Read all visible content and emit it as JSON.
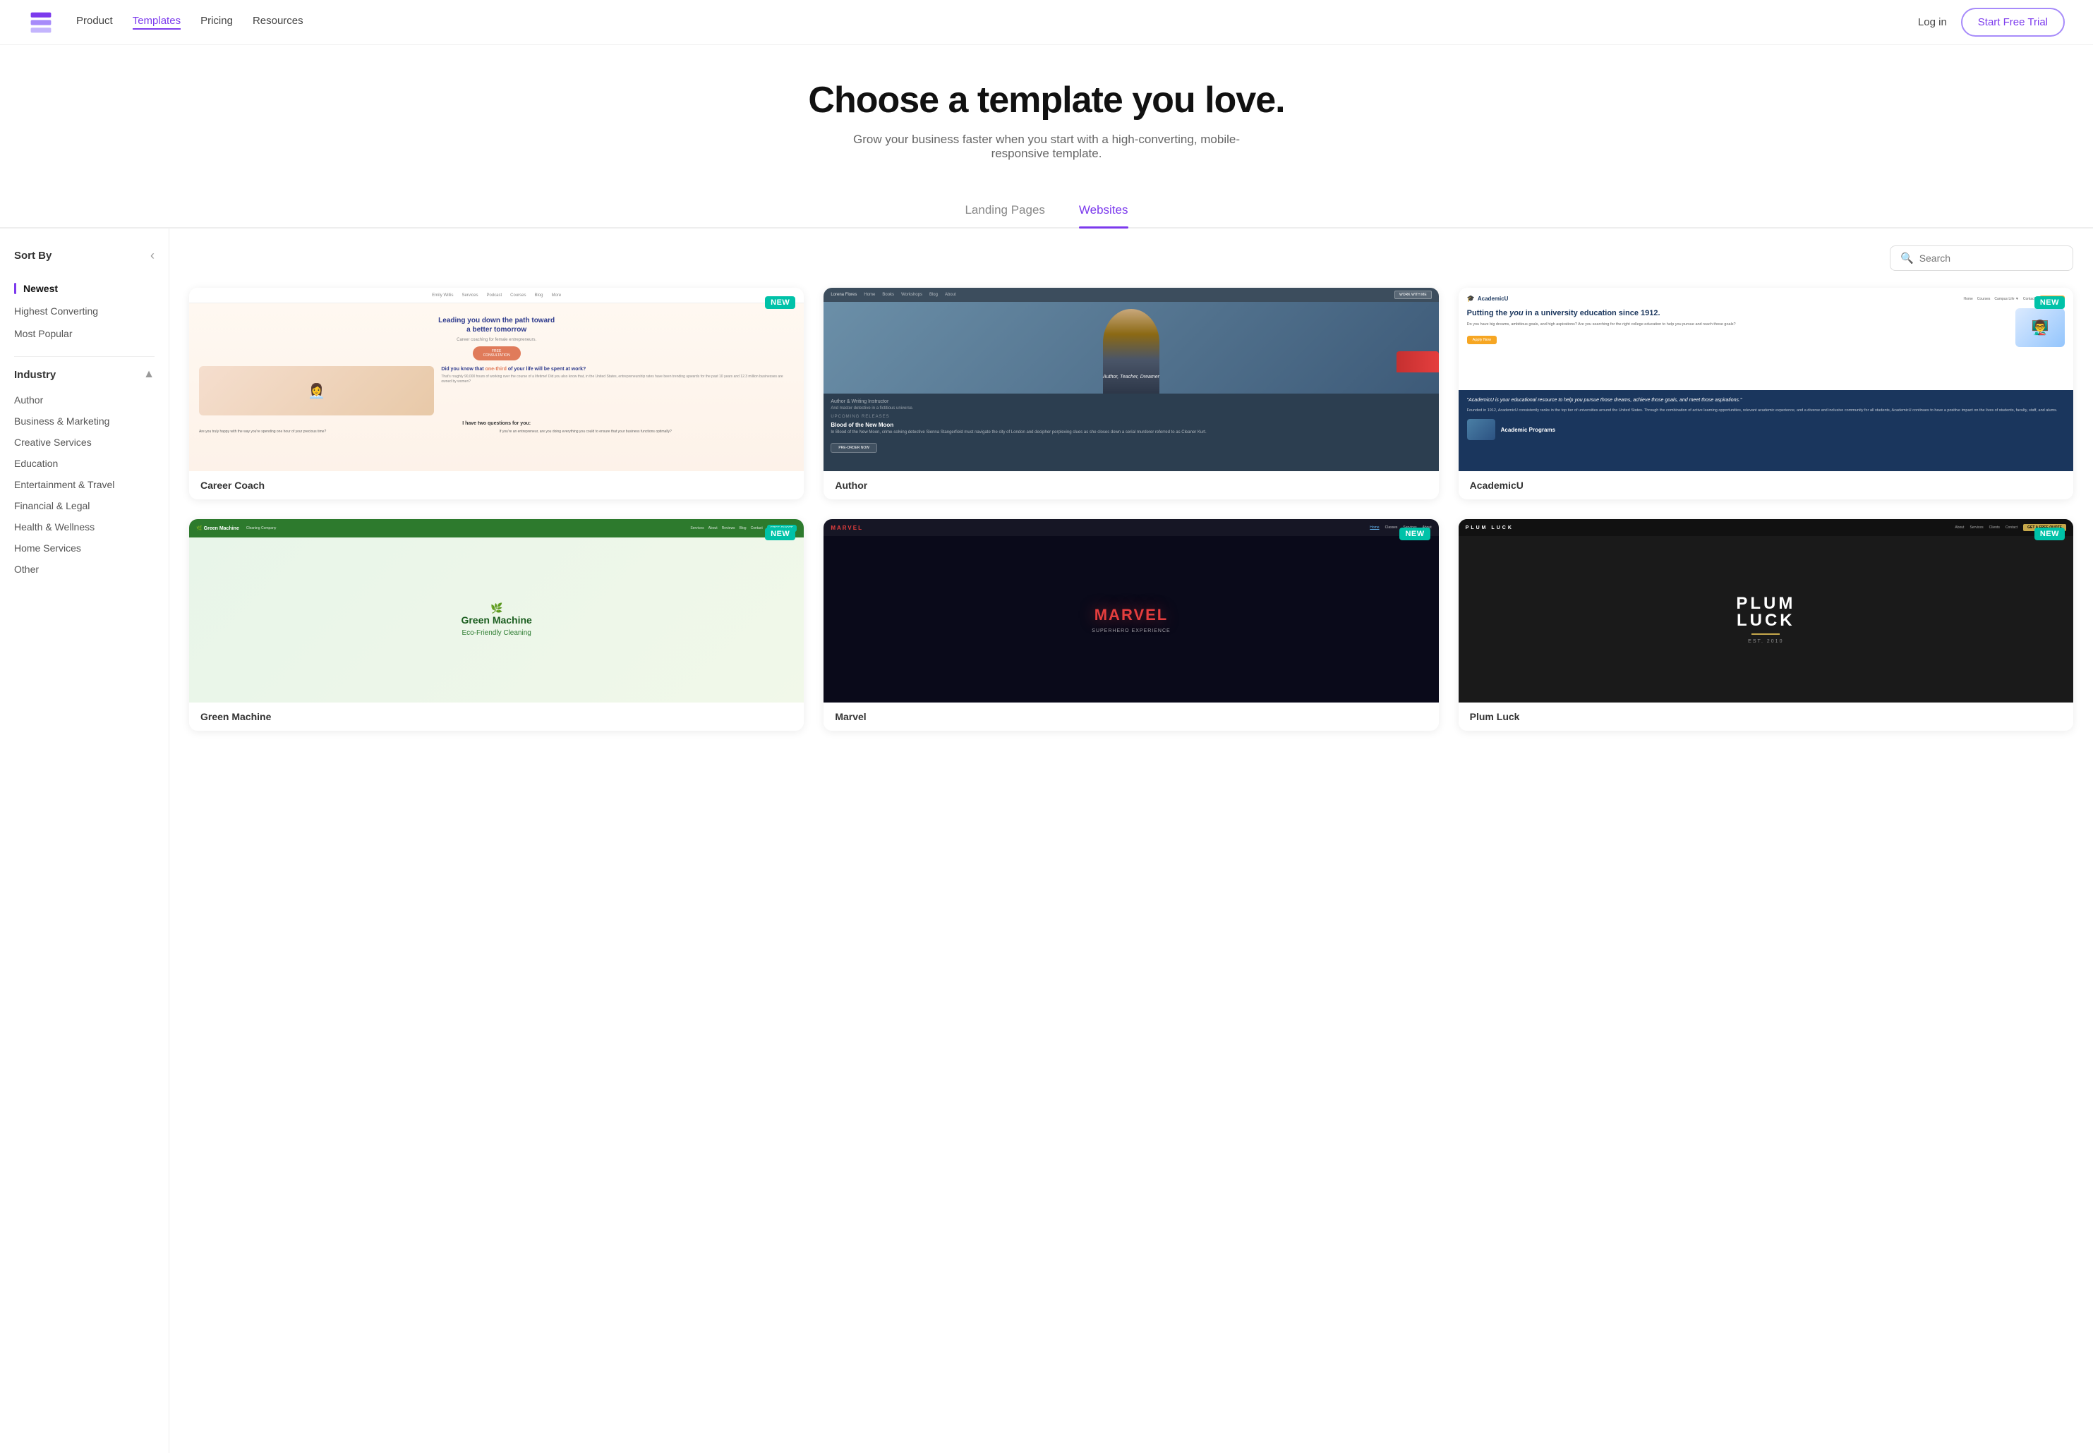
{
  "nav": {
    "logo_alt": "Logo",
    "links": [
      {
        "label": "Product",
        "active": false
      },
      {
        "label": "Templates",
        "active": true
      },
      {
        "label": "Pricing",
        "active": false
      },
      {
        "label": "Resources",
        "active": false
      }
    ],
    "login_label": "Log in",
    "trial_label": "Start Free Trial"
  },
  "hero": {
    "title": "Choose a template you love.",
    "subtitle": "Grow your business faster when you start with a high-converting, mobile-responsive template."
  },
  "tabs": [
    {
      "label": "Landing Pages",
      "active": false
    },
    {
      "label": "Websites",
      "active": true
    }
  ],
  "sidebar": {
    "sort_by_label": "Sort By",
    "collapse_icon": "‹",
    "sort_items": [
      {
        "label": "Newest",
        "active": true
      },
      {
        "label": "Highest Converting",
        "active": false
      },
      {
        "label": "Most Popular",
        "active": false
      }
    ],
    "industry_label": "Industry",
    "industry_items": [
      {
        "label": "Author"
      },
      {
        "label": "Business & Marketing"
      },
      {
        "label": "Creative Services"
      },
      {
        "label": "Education"
      },
      {
        "label": "Entertainment & Travel"
      },
      {
        "label": "Financial & Legal"
      },
      {
        "label": "Health & Wellness"
      },
      {
        "label": "Home Services"
      },
      {
        "label": "Other"
      }
    ]
  },
  "toolbar": {
    "search_placeholder": "Search"
  },
  "templates": [
    {
      "id": "career-coach",
      "title": "Career Coach",
      "is_new": true,
      "preview_type": "career"
    },
    {
      "id": "author",
      "title": "Author",
      "is_new": false,
      "preview_type": "author"
    },
    {
      "id": "academicu",
      "title": "AcademicU",
      "is_new": true,
      "preview_type": "academicu"
    },
    {
      "id": "green-machine",
      "title": "Green Machine",
      "is_new": true,
      "preview_type": "green"
    },
    {
      "id": "marvel",
      "title": "Marvel",
      "is_new": true,
      "preview_type": "marvel"
    },
    {
      "id": "plum-luck",
      "title": "Plum Luck",
      "is_new": true,
      "preview_type": "plum"
    }
  ],
  "badges": {
    "new_label": "NEW"
  }
}
